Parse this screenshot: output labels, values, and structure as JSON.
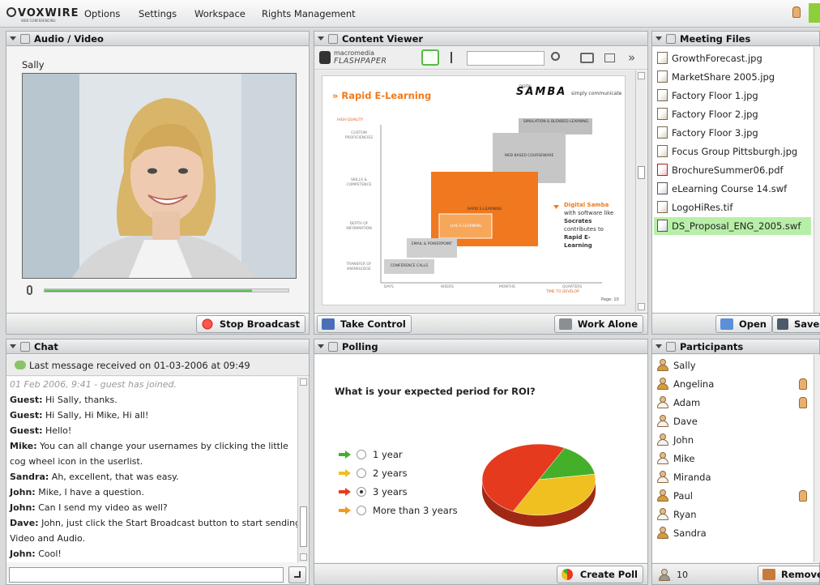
{
  "topbar": {
    "logo": "VOXWIRE",
    "logo_sub": "WEB CONFERENCING",
    "menu": [
      "Options",
      "Settings",
      "Workspace",
      "Rights Management"
    ]
  },
  "audio_video": {
    "title": "Audio / Video",
    "user_name": "Sally",
    "volume_level": 0.85,
    "button": "Stop Broadcast"
  },
  "content_viewer": {
    "title": "Content Viewer",
    "brand_top": "macromedia",
    "brand_bottom": "FLASHPAPER",
    "toolbar_more": "»",
    "slide": {
      "title": "» Rapid E-Learning",
      "samba_logo": "SAMBA",
      "samba_tag": "simply communicate",
      "samba_sup": "DIGITAL",
      "y_labels": [
        "HIGH QUALITY",
        "CUSTOM PROFICIENCIES",
        "SKILLS & COMPETENCE",
        "DEPTH OF INFORMATION",
        "TRANSFER OF KNOWLEDGE"
      ],
      "x_labels": [
        "DAYS",
        "WEEKS",
        "MONTHS",
        "QUARTERS"
      ],
      "x_sub": "TIME TO DEVELOP",
      "boxes": [
        "SIMULATION & BLENDED LEARNING",
        "WEB BASED COURSEWARE",
        "RAPID E-LEARNING",
        "LIVE E-LEARNING",
        "EMAIL & POWERPOINT",
        "CONFERENCE CALLS"
      ],
      "side_text_1": "Digital Samba",
      "side_text_2": "with software like",
      "side_text_3": "Socrates",
      "side_text_4": "contributes to",
      "side_text_5": "Rapid E-Learning",
      "page_label": "Page: 10"
    },
    "button_left": "Take Control",
    "button_right": "Work Alone"
  },
  "meeting_files": {
    "title": "Meeting Files",
    "files": [
      "GrowthForecast.jpg",
      "MarketShare 2005.jpg",
      "Factory Floor 1.jpg",
      "Factory Floor 2.jpg",
      "Factory Floor 3.jpg",
      "Focus Group Pittsburgh.jpg",
      "BrochureSummer06.pdf",
      "eLearning Course 14.swf",
      "LogoHiRes.tif",
      "DS_Proposal_ENG_2005.swf"
    ],
    "selected_index": 9,
    "button_open": "Open",
    "button_save": "Save"
  },
  "chat": {
    "title": "Chat",
    "status": "Last message received on 01-03-2006 at 09:49",
    "system_line": "01 Feb 2006, 9:41 - guest has joined.",
    "messages": [
      {
        "who": "Guest:",
        "text": " Hi Sally, thanks."
      },
      {
        "who": "Guest:",
        "text": " Hi Sally, Hi Mike, Hi all!"
      },
      {
        "who": "Guest:",
        "text": " Hello!"
      },
      {
        "who": "Mike:",
        "text": " You can all change your usernames by clicking the little"
      },
      {
        "who": "",
        "text": "cog wheel icon in the userlist."
      },
      {
        "who": "Sandra:",
        "text": " Ah, excellent, that was easy."
      },
      {
        "who": "John:",
        "text": " Mike, I have a question."
      },
      {
        "who": "John:",
        "text": " Can I send my video as well?"
      },
      {
        "who": "Dave:",
        "text": " John, just click the Start Broadcast button to start sending"
      },
      {
        "who": "",
        "text": "Video and Audio."
      },
      {
        "who": "John:",
        "text": " Cool!"
      }
    ],
    "input_value": ""
  },
  "polling": {
    "title": "Polling",
    "question": "What is your expected period for ROI?",
    "options": [
      {
        "label": "1 year",
        "color": "#44b02a",
        "selected": false,
        "share": 0.15
      },
      {
        "label": "2 years",
        "color": "#f0c020",
        "selected": false,
        "share": 0.35
      },
      {
        "label": "3 years",
        "color": "#e53a1e",
        "selected": true,
        "share": 0.5
      },
      {
        "label": "More than 3 years",
        "color": "#f39a1c",
        "selected": false,
        "share": 0
      }
    ],
    "button": "Create Poll"
  },
  "participants": {
    "title": "Participants",
    "list": [
      {
        "name": "Sally",
        "hand": false
      },
      {
        "name": "Angelina",
        "hand": true
      },
      {
        "name": "Adam",
        "hand": true
      },
      {
        "name": "Dave",
        "hand": false
      },
      {
        "name": "John",
        "hand": false
      },
      {
        "name": "Mike",
        "hand": false
      },
      {
        "name": "Miranda",
        "hand": false
      },
      {
        "name": "Paul",
        "hand": true
      },
      {
        "name": "Ryan",
        "hand": false
      },
      {
        "name": "Sandra",
        "hand": false
      }
    ],
    "count": "10",
    "button": "Remove"
  }
}
